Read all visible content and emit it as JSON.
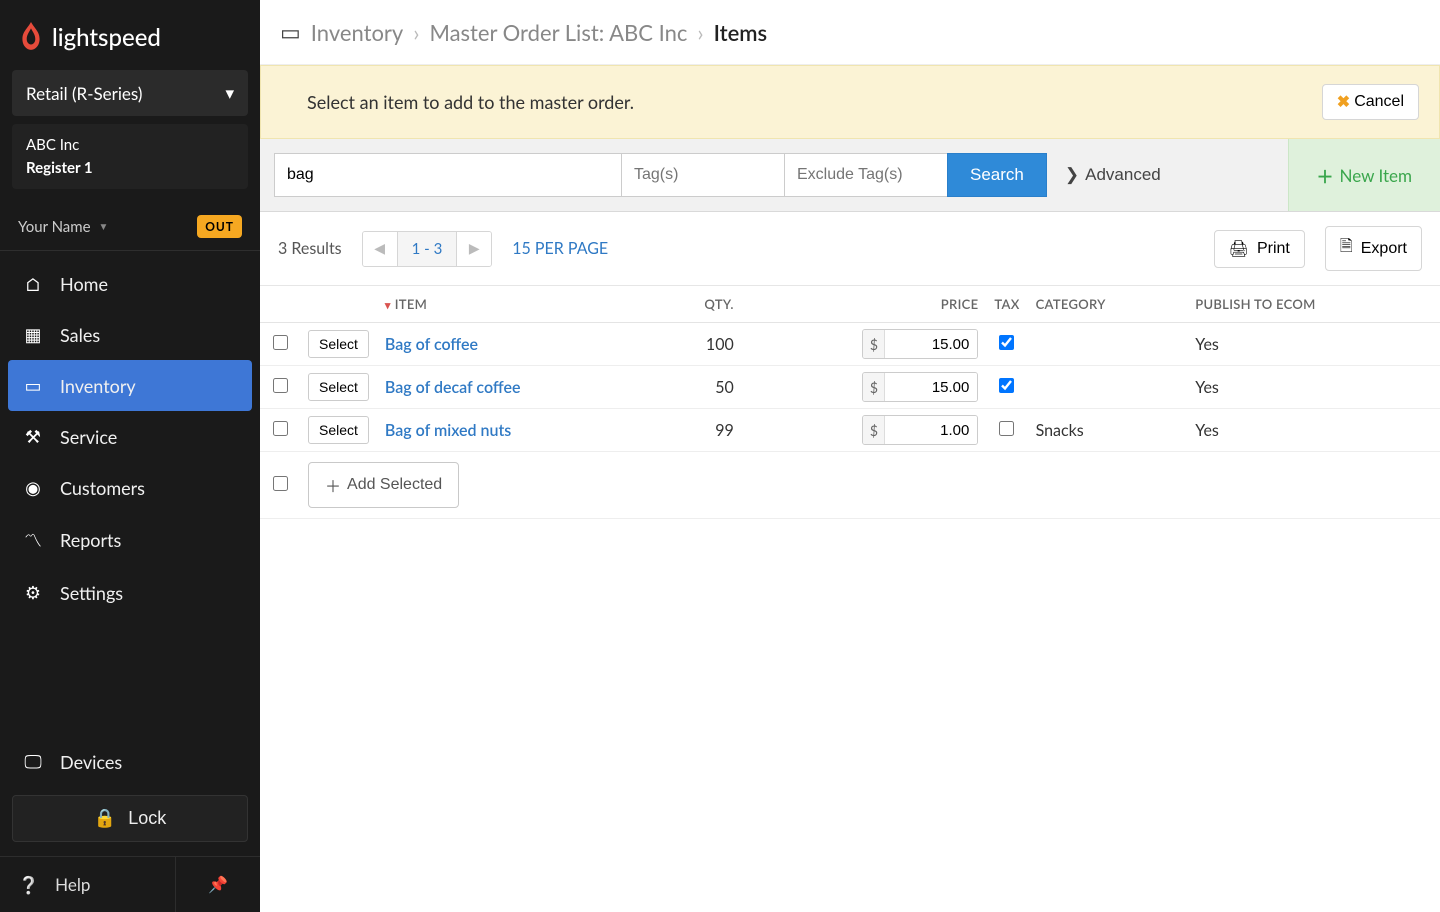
{
  "brand": "lightspeed",
  "series_selector": "Retail (R-Series)",
  "account": {
    "company": "ABC Inc",
    "register": "Register 1"
  },
  "user": {
    "name": "Your Name",
    "status_badge": "OUT"
  },
  "nav": [
    {
      "key": "home",
      "label": "Home"
    },
    {
      "key": "sales",
      "label": "Sales"
    },
    {
      "key": "inventory",
      "label": "Inventory",
      "active": true
    },
    {
      "key": "service",
      "label": "Service"
    },
    {
      "key": "customers",
      "label": "Customers"
    },
    {
      "key": "reports",
      "label": "Reports"
    },
    {
      "key": "settings",
      "label": "Settings"
    }
  ],
  "devices_label": "Devices",
  "lock_label": "Lock",
  "help_label": "Help",
  "breadcrumb": {
    "root": "Inventory",
    "mid": "Master Order List:  ABC Inc",
    "leaf": "Items"
  },
  "notice": {
    "msg": "Select an item to add to the master order.",
    "cancel": "Cancel"
  },
  "search": {
    "query": "bag",
    "tags_placeholder": "Tag(s)",
    "excl_placeholder": "Exclude Tag(s)",
    "search_btn": "Search",
    "advanced": "Advanced",
    "new_item": "New Item"
  },
  "results_bar": {
    "count_text": "3 Results",
    "range": "1 - 3",
    "per_page": "15 PER PAGE",
    "print": "Print",
    "export": "Export"
  },
  "table": {
    "headers": {
      "item": "ITEM",
      "qty": "QTY.",
      "price": "PRICE",
      "tax": "TAX",
      "category": "CATEGORY",
      "ecom": "PUBLISH TO ECOM"
    },
    "select_btn": "Select",
    "currency": "$",
    "rows": [
      {
        "name": "Bag of coffee",
        "qty": "100",
        "price": "15.00",
        "tax": true,
        "category": "",
        "ecom": "Yes"
      },
      {
        "name": "Bag of decaf coffee",
        "qty": "50",
        "price": "15.00",
        "tax": true,
        "category": "",
        "ecom": "Yes"
      },
      {
        "name": "Bag of mixed nuts",
        "qty": "99",
        "price": "1.00",
        "tax": false,
        "category": "Snacks",
        "ecom": "Yes"
      }
    ],
    "add_selected": "Add Selected"
  }
}
